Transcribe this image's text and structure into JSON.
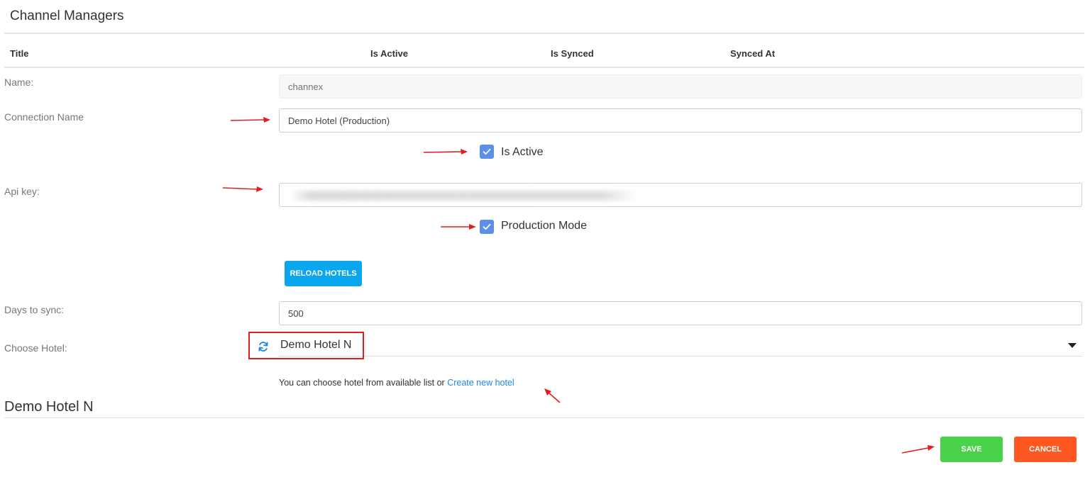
{
  "page": {
    "title": "Channel Managers"
  },
  "table": {
    "columns": [
      "Title",
      "Is Active",
      "Is Synced",
      "Synced At"
    ]
  },
  "form": {
    "name": {
      "label": "Name:",
      "placeholder": "channex"
    },
    "connection_name": {
      "label": "Connection Name",
      "value": "Demo Hotel (Production)"
    },
    "is_active": {
      "label": "Is Active",
      "checked": true
    },
    "api_key": {
      "label": "Api key:",
      "value": ""
    },
    "production_mode": {
      "label": "Production Mode",
      "checked": true
    },
    "reload_hotels_label": "RELOAD HOTELS",
    "days_to_sync": {
      "label": "Days to sync:",
      "value": "500"
    },
    "choose_hotel": {
      "label": "Choose Hotel:",
      "selected": "Demo Hotel N",
      "refresh_icon": "refresh-icon",
      "caret_icon": "caret-down-icon"
    },
    "hint": {
      "text": "You can choose hotel from available list or ",
      "link": "Create new hotel"
    }
  },
  "section": {
    "title": "Demo Hotel N"
  },
  "actions": {
    "save_label": "SAVE",
    "cancel_label": "CANCEL"
  },
  "colors": {
    "checkbox": "#5d8fe6",
    "reload": "#0aa7ee",
    "save": "#49d249",
    "cancel": "#ff5722",
    "link": "#1e88e5",
    "annotation": "#e02020"
  }
}
